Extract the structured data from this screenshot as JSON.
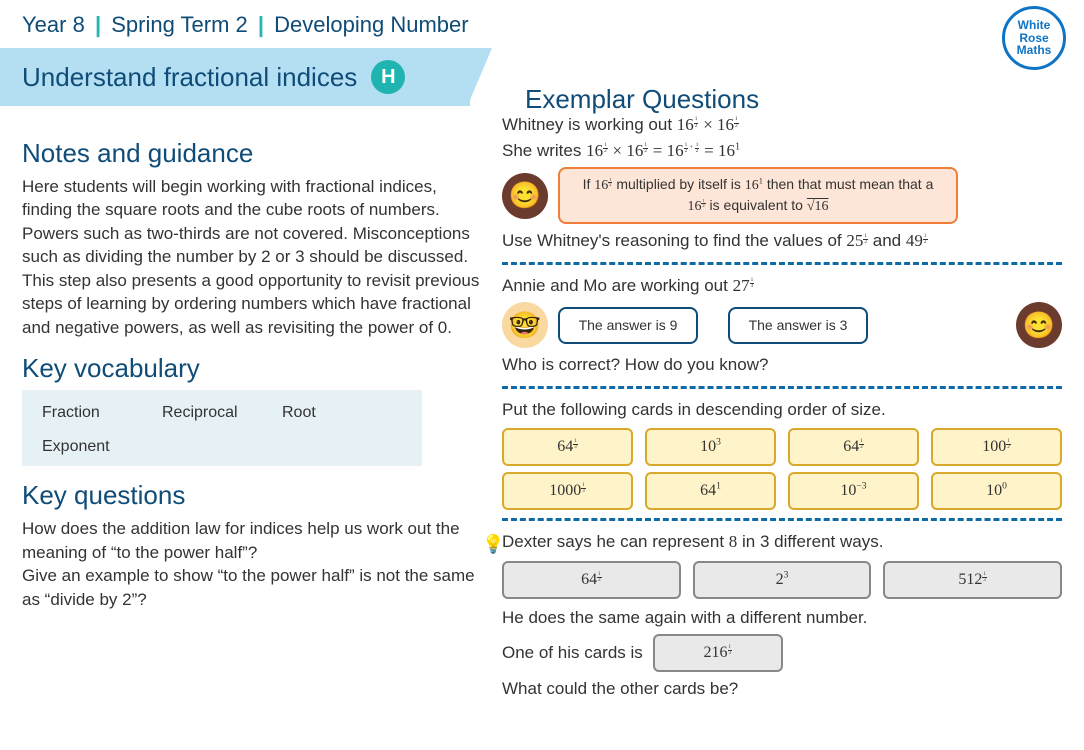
{
  "header": {
    "year": "Year 8",
    "term": "Spring Term 2",
    "topic": "Developing Number"
  },
  "logo": {
    "l1": "White",
    "l2": "Rose",
    "l3": "Maths"
  },
  "banner": {
    "title": "Understand fractional indices",
    "badge": "H"
  },
  "left": {
    "notes_h": "Notes and guidance",
    "notes": "Here students will begin working with fractional indices, finding the square roots and the cube roots of numbers. Powers such as two-thirds are not covered. Misconceptions such as dividing the number by 2 or 3 should be discussed. This step also presents a good opportunity to revisit previous steps of learning by ordering numbers which have fractional and negative powers, as well as revisiting the power of 0.",
    "vocab_h": "Key vocabulary",
    "vocab": [
      "Fraction",
      "Reciprocal",
      "Root",
      "Exponent"
    ],
    "kq_h": "Key questions",
    "kq1": "How does the addition law for indices help us work out the meaning of “to the power half”?",
    "kq2": "Give an example to show “to the power half” is not the same as “divide by 2”?"
  },
  "right": {
    "heading": "Exemplar Questions",
    "q1a": "Whitney is working out ",
    "q1b": "She writes ",
    "speech1a": "If ",
    "speech1b": " multiplied by itself is ",
    "speech1c": " then that must mean that a ",
    "speech1d": " is equivalent to ",
    "q1c": "Use Whitney's reasoning to find the values of ",
    "q1c_and": " and ",
    "q2a": "Annie and Mo are working out ",
    "ans9": "The answer is 9",
    "ans3": "The answer is 3",
    "q2b": "Who is correct? How do you know?",
    "q3a": "Put the following cards in descending order of size.",
    "q4a": "Dexter says he can represent ",
    "q4b": " in 3 different ways.",
    "q4c": "He does the same again with a different number.",
    "q4d": "One of his cards is",
    "q4e": "What could the other cards be?"
  },
  "math": {
    "b16": "16",
    "b25": "25",
    "b49": "49",
    "b27": "27",
    "b64": "64",
    "b10": "10",
    "b100": "100",
    "b1000": "1000",
    "b512": "512",
    "b216": "216",
    "b2": "2",
    "b8": "8",
    "n1": "1",
    "n2": "2",
    "n3": "3",
    "m3": "−3",
    "z0": "0",
    "eq": " = ",
    "times": " × ",
    "plus": " + ",
    "root16": "16"
  }
}
